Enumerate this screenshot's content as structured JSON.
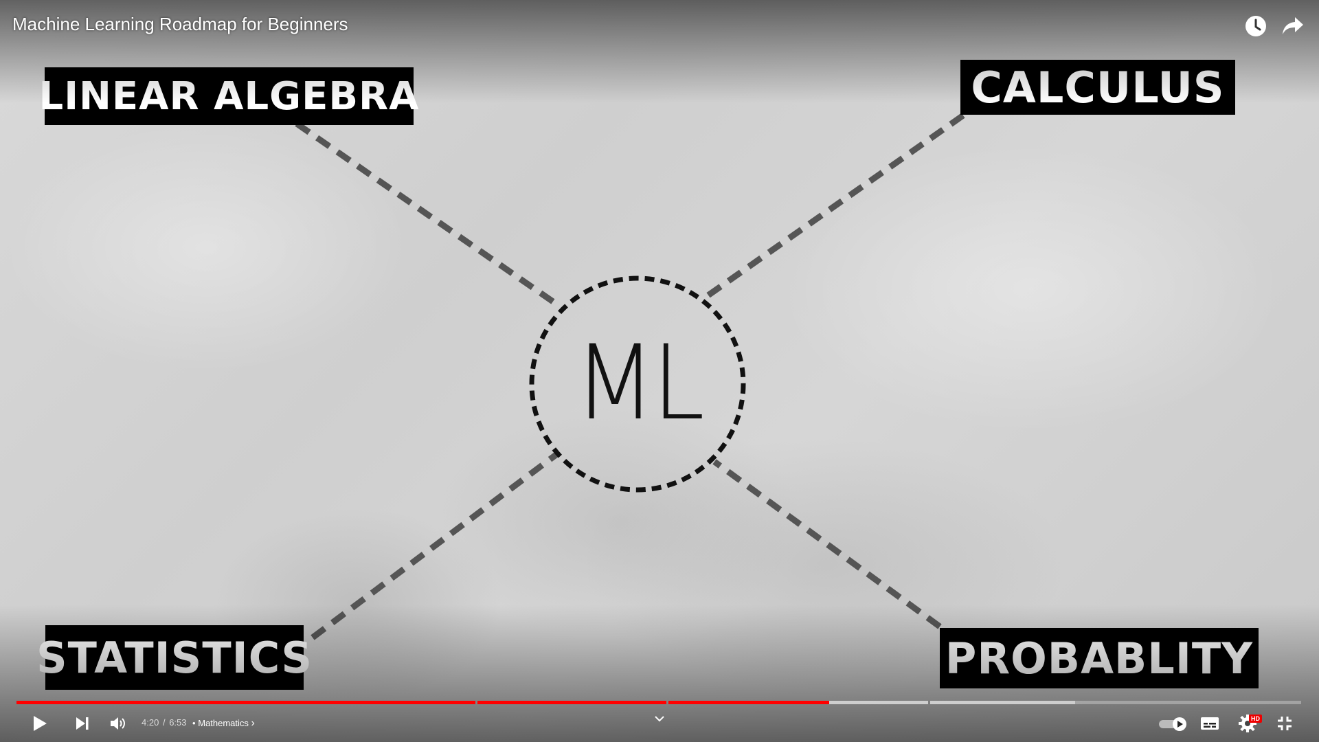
{
  "video": {
    "title": "Machine Learning Roadmap for Beginners"
  },
  "top_actions": {
    "watch_later_icon": "clock-icon",
    "share_icon": "share-arrow-icon"
  },
  "diagram": {
    "center_label": "ML",
    "topics": {
      "top_left": "LINEAR ALGEBRA",
      "top_right": "CALCULUS",
      "bottom_left": "STATISTICS",
      "bottom_right": "PROBABLITY"
    }
  },
  "progress": {
    "played_fraction": 0.63,
    "buffered_fraction": 0.8,
    "colors": {
      "played": "#ff0000",
      "buffered": "#dcdcdc",
      "track": "#ffffff4d"
    }
  },
  "controls": {
    "current_time": "4:20",
    "separator": "/",
    "duration": "6:53",
    "bullet": "•",
    "chapter": "Mathematics",
    "chapter_chevron": "›",
    "hd_badge": "HD"
  },
  "colors": {
    "label_bg": "#000000",
    "label_text": "#ffffff",
    "connector": "#555555"
  }
}
